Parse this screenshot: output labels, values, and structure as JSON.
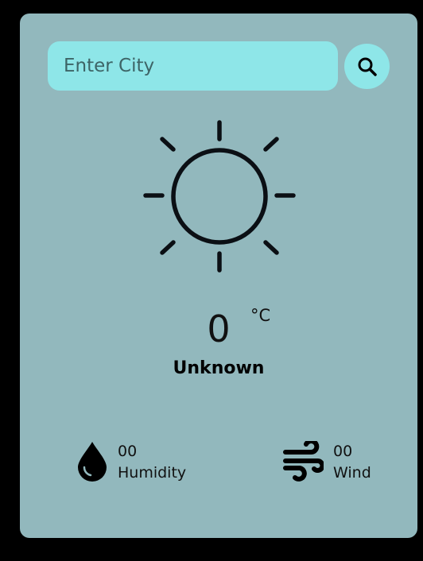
{
  "search": {
    "placeholder": "Enter City",
    "icon": "search-icon"
  },
  "weather": {
    "icon": "sun-icon",
    "temperature": "0",
    "unit": "°C",
    "condition": "Unknown"
  },
  "stats": {
    "humidity": {
      "icon": "water-drop-icon",
      "value": "00",
      "label": "Humidity"
    },
    "wind": {
      "icon": "wind-icon",
      "value": "00",
      "label": "Wind"
    }
  },
  "colors": {
    "card": "#92b8bd",
    "input": "#8ee6e8",
    "background": "#000000"
  }
}
